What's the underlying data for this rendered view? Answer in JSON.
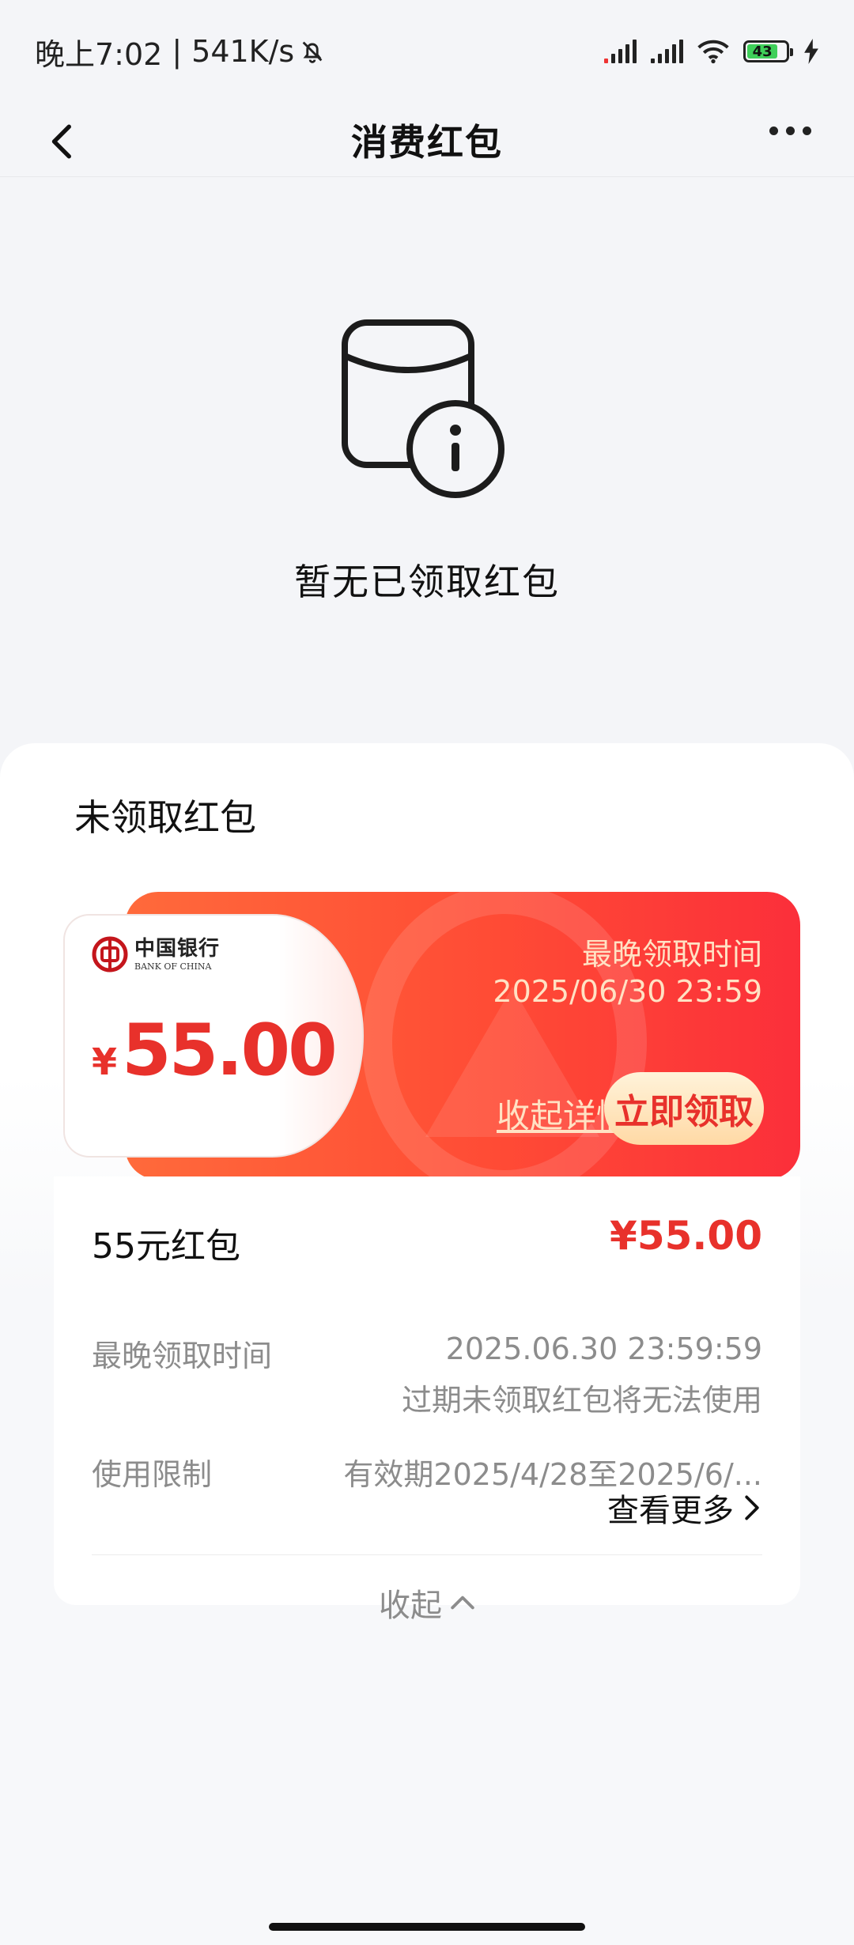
{
  "status_bar": {
    "time": "晚上7:02",
    "separator": "|",
    "speed": "541K/s",
    "battery": "43",
    "icons": [
      "bell-off-icon",
      "signal-hd-icon",
      "signal-icon",
      "wifi-icon",
      "battery-icon",
      "charging-icon"
    ]
  },
  "nav": {
    "title": "消费红包",
    "back_icon": "chevron-left-icon",
    "more_icon": "more-dots-icon"
  },
  "empty_state": {
    "icon": "envelope-info-icon",
    "text": "暂无已领取红包"
  },
  "sheet": {
    "title": "未领取红包"
  },
  "coupon": {
    "bank_cn": "中国银行",
    "bank_en": "BANK OF CHINA",
    "currency": "¥",
    "amount": "55.00",
    "deadline_label": "最晚领取时间",
    "deadline_value": "2025/06/30 23:59",
    "collapse_label": "收起详情",
    "claim_label": "立即领取"
  },
  "details": {
    "name": "55元红包",
    "price": "¥55.00",
    "deadline_label": "最晚领取时间",
    "deadline_value": "2025.06.30 23:59:59",
    "deadline_note": "过期未领取红包将无法使用",
    "limit_label": "使用限制",
    "limit_value": "有效期2025/4/28至2025/6/...",
    "more_label": "查看更多",
    "collapse_label": "收起"
  },
  "colors": {
    "accent_red": "#e8312b",
    "coupon_gradient_start": "#ff6a3b",
    "coupon_gradient_end": "#fb2f3a",
    "button_gold": "#ffd9a5"
  }
}
